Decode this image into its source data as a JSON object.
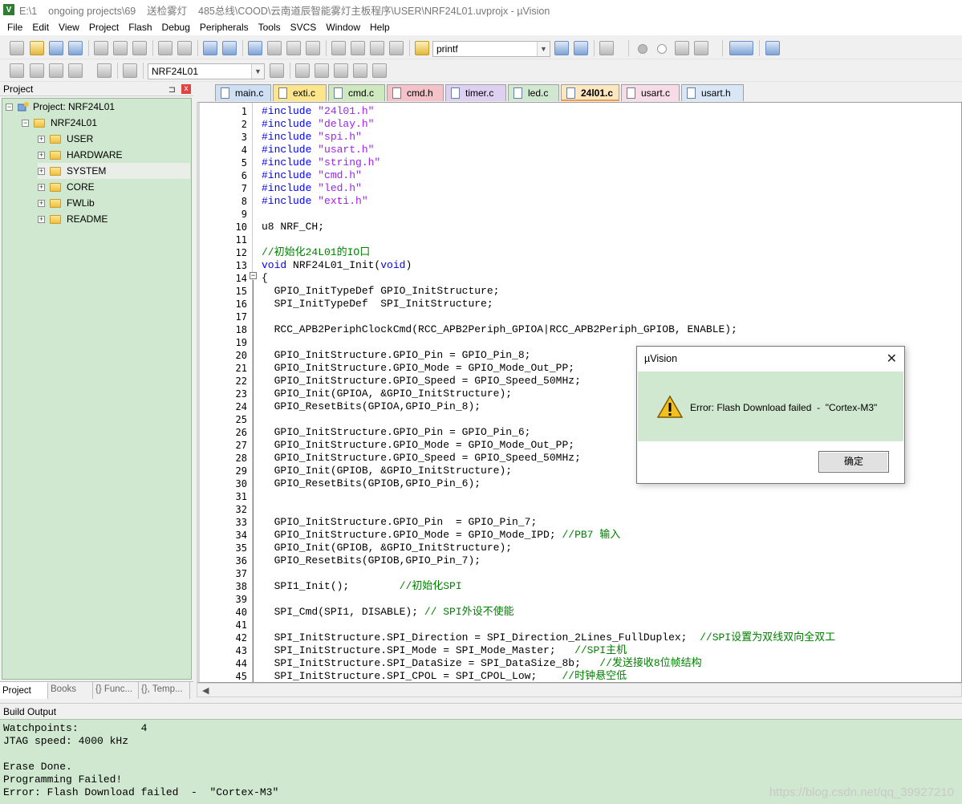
{
  "window": {
    "title": "E:\\1    ongoing projects\\69    送检雾灯    485总线\\COOD\\云南道辰智能雾灯主板程序\\USER\\NRF24L01.uvprojx - µVision",
    "app_icon_letter": "V"
  },
  "menu": [
    "File",
    "Edit",
    "View",
    "Project",
    "Flash",
    "Debug",
    "Peripherals",
    "Tools",
    "SVCS",
    "Window",
    "Help"
  ],
  "toolbar": {
    "find_combo_value": "printf",
    "target_combo_value": "NRF24L01"
  },
  "project_panel": {
    "title": "Project",
    "pin_glyph": "📌",
    "close_glyph": "x",
    "root": "Project: NRF24L01",
    "target": "NRF24L01",
    "groups": [
      "USER",
      "HARDWARE",
      "SYSTEM",
      "CORE",
      "FWLib",
      "README"
    ],
    "selected_group": "SYSTEM",
    "bottom_tabs": [
      {
        "label": "Project",
        "active": true
      },
      {
        "label": "Books",
        "active": false
      },
      {
        "label": "{} Func...",
        "active": false
      },
      {
        "label": "{}, Temp...",
        "active": false
      }
    ]
  },
  "file_tabs": [
    {
      "label": "main.c",
      "color": "#cfe0f5",
      "active": false
    },
    {
      "label": "exti.c",
      "color": "#fde68a",
      "active": false
    },
    {
      "label": "cmd.c",
      "color": "#cfe8c0",
      "active": false
    },
    {
      "label": "cmd.h",
      "color": "#f4c2c8",
      "active": false
    },
    {
      "label": "timer.c",
      "color": "#ddd0f0",
      "active": false
    },
    {
      "label": "led.c",
      "color": "#cfe8cf",
      "active": false
    },
    {
      "label": "24l01.c",
      "color": "#fde7c0",
      "active": true
    },
    {
      "label": "usart.c",
      "color": "#f7dbe6",
      "active": false
    },
    {
      "label": "usart.h",
      "color": "#d8e6f6",
      "active": false
    }
  ],
  "code_lines": [
    {
      "n": "1",
      "segs": [
        {
          "t": "#include ",
          "c": "#0000ff"
        },
        {
          "t": "\"24l01.h\"",
          "c": "#a020f0"
        }
      ]
    },
    {
      "n": "2",
      "segs": [
        {
          "t": "#include ",
          "c": "#0000ff"
        },
        {
          "t": "\"delay.h\"",
          "c": "#a020f0"
        }
      ]
    },
    {
      "n": "3",
      "segs": [
        {
          "t": "#include ",
          "c": "#0000ff"
        },
        {
          "t": "\"spi.h\"",
          "c": "#a020f0"
        }
      ]
    },
    {
      "n": "4",
      "segs": [
        {
          "t": "#include ",
          "c": "#0000ff"
        },
        {
          "t": "\"usart.h\"",
          "c": "#a020f0"
        }
      ]
    },
    {
      "n": "5",
      "segs": [
        {
          "t": "#include ",
          "c": "#0000ff"
        },
        {
          "t": "\"string.h\"",
          "c": "#a020f0"
        }
      ]
    },
    {
      "n": "6",
      "segs": [
        {
          "t": "#include ",
          "c": "#0000ff"
        },
        {
          "t": "\"cmd.h\"",
          "c": "#a020f0"
        }
      ]
    },
    {
      "n": "7",
      "segs": [
        {
          "t": "#include ",
          "c": "#0000ff"
        },
        {
          "t": "\"led.h\"",
          "c": "#a020f0"
        }
      ]
    },
    {
      "n": "8",
      "segs": [
        {
          "t": "#include ",
          "c": "#0000ff"
        },
        {
          "t": "\"exti.h\"",
          "c": "#a020f0"
        }
      ]
    },
    {
      "n": "9",
      "segs": []
    },
    {
      "n": "10",
      "segs": [
        {
          "t": "u8 NRF_CH;",
          "c": "#000000"
        }
      ]
    },
    {
      "n": "11",
      "segs": []
    },
    {
      "n": "12",
      "segs": [
        {
          "t": "//初始化24L01的IO口",
          "c": "#008000"
        }
      ]
    },
    {
      "n": "13",
      "segs": [
        {
          "t": "void",
          "c": "#0000ff"
        },
        {
          "t": " NRF24L01_Init(",
          "c": "#000000"
        },
        {
          "t": "void",
          "c": "#0000ff"
        },
        {
          "t": ")",
          "c": "#000000"
        }
      ]
    },
    {
      "n": "14",
      "segs": [
        {
          "t": "{",
          "c": "#000000"
        }
      ]
    },
    {
      "n": "15",
      "segs": [
        {
          "t": "  GPIO_InitTypeDef GPIO_InitStructure;",
          "c": "#000000"
        }
      ]
    },
    {
      "n": "16",
      "segs": [
        {
          "t": "  SPI_InitTypeDef  SPI_InitStructure;",
          "c": "#000000"
        }
      ]
    },
    {
      "n": "17",
      "segs": []
    },
    {
      "n": "18",
      "segs": [
        {
          "t": "  RCC_APB2PeriphClockCmd(RCC_APB2Periph_GPIOA|RCC_APB2Periph_GPIOB, ENABLE);",
          "c": "#000000"
        }
      ]
    },
    {
      "n": "19",
      "segs": []
    },
    {
      "n": "20",
      "segs": [
        {
          "t": "  GPIO_InitStructure.GPIO_Pin = GPIO_Pin_8;",
          "c": "#000000"
        }
      ]
    },
    {
      "n": "21",
      "segs": [
        {
          "t": "  GPIO_InitStructure.GPIO_Mode = GPIO_Mode_Out_PP;",
          "c": "#000000"
        }
      ]
    },
    {
      "n": "22",
      "segs": [
        {
          "t": "  GPIO_InitStructure.GPIO_Speed = GPIO_Speed_50MHz;",
          "c": "#000000"
        }
      ]
    },
    {
      "n": "23",
      "segs": [
        {
          "t": "  GPIO_Init(GPIOA, &GPIO_InitStructure);",
          "c": "#000000"
        }
      ]
    },
    {
      "n": "24",
      "segs": [
        {
          "t": "  GPIO_ResetBits(GPIOA,GPIO_Pin_8);",
          "c": "#000000"
        }
      ]
    },
    {
      "n": "25",
      "segs": []
    },
    {
      "n": "26",
      "segs": [
        {
          "t": "  GPIO_InitStructure.GPIO_Pin = GPIO_Pin_6;",
          "c": "#000000"
        }
      ]
    },
    {
      "n": "27",
      "segs": [
        {
          "t": "  GPIO_InitStructure.GPIO_Mode = GPIO_Mode_Out_PP;",
          "c": "#000000"
        }
      ]
    },
    {
      "n": "28",
      "segs": [
        {
          "t": "  GPIO_InitStructure.GPIO_Speed = GPIO_Speed_50MHz;",
          "c": "#000000"
        }
      ]
    },
    {
      "n": "29",
      "segs": [
        {
          "t": "  GPIO_Init(GPIOB, &GPIO_InitStructure);",
          "c": "#000000"
        }
      ]
    },
    {
      "n": "30",
      "segs": [
        {
          "t": "  GPIO_ResetBits(GPIOB,GPIO_Pin_6);",
          "c": "#000000"
        }
      ]
    },
    {
      "n": "31",
      "segs": []
    },
    {
      "n": "32",
      "segs": []
    },
    {
      "n": "33",
      "segs": [
        {
          "t": "  GPIO_InitStructure.GPIO_Pin  = GPIO_Pin_7;",
          "c": "#000000"
        }
      ]
    },
    {
      "n": "34",
      "segs": [
        {
          "t": "  GPIO_InitStructure.GPIO_Mode = GPIO_Mode_IPD; ",
          "c": "#000000"
        },
        {
          "t": "//PB7 输入",
          "c": "#008000"
        }
      ]
    },
    {
      "n": "35",
      "segs": [
        {
          "t": "  GPIO_Init(GPIOB, &GPIO_InitStructure);",
          "c": "#000000"
        }
      ]
    },
    {
      "n": "36",
      "segs": [
        {
          "t": "  GPIO_ResetBits(GPIOB,GPIO_Pin_7);",
          "c": "#000000"
        }
      ]
    },
    {
      "n": "37",
      "segs": []
    },
    {
      "n": "38",
      "segs": [
        {
          "t": "  SPI1_Init();        ",
          "c": "#000000"
        },
        {
          "t": "//初始化SPI",
          "c": "#008000"
        }
      ]
    },
    {
      "n": "39",
      "segs": []
    },
    {
      "n": "40",
      "segs": [
        {
          "t": "  SPI_Cmd(SPI1, DISABLE); ",
          "c": "#000000"
        },
        {
          "t": "// SPI外设不使能",
          "c": "#008000"
        }
      ]
    },
    {
      "n": "41",
      "segs": []
    },
    {
      "n": "42",
      "segs": [
        {
          "t": "  SPI_InitStructure.SPI_Direction = SPI_Direction_2Lines_FullDuplex;  ",
          "c": "#000000"
        },
        {
          "t": "//SPI设置为双线双向全双工",
          "c": "#008000"
        }
      ]
    },
    {
      "n": "43",
      "segs": [
        {
          "t": "  SPI_InitStructure.SPI_Mode = SPI_Mode_Master;   ",
          "c": "#000000"
        },
        {
          "t": "//SPI主机",
          "c": "#008000"
        }
      ]
    },
    {
      "n": "44",
      "segs": [
        {
          "t": "  SPI_InitStructure.SPI_DataSize = SPI_DataSize_8b;   ",
          "c": "#000000"
        },
        {
          "t": "//发送接收8位帧结构",
          "c": "#008000"
        }
      ]
    },
    {
      "n": "45",
      "segs": [
        {
          "t": "  SPI_InitStructure.SPI_CPOL = SPI_CPOL_Low;    ",
          "c": "#000000"
        },
        {
          "t": "//时钟悬空低",
          "c": "#008000"
        }
      ]
    }
  ],
  "dialog": {
    "title": "µVision",
    "close_glyph": "✕",
    "message": "Error: Flash Download failed  -  \"Cortex-M3\"",
    "ok_label": "确定"
  },
  "build_output": {
    "title": "Build Output",
    "lines": [
      "Watchpoints:          4",
      "JTAG speed: 4000 kHz",
      "",
      "Erase Done.",
      "Programming Failed!",
      "Error: Flash Download failed  -  \"Cortex-M3\""
    ]
  },
  "watermark": "https://blog.csdn.net/qq_39927210"
}
